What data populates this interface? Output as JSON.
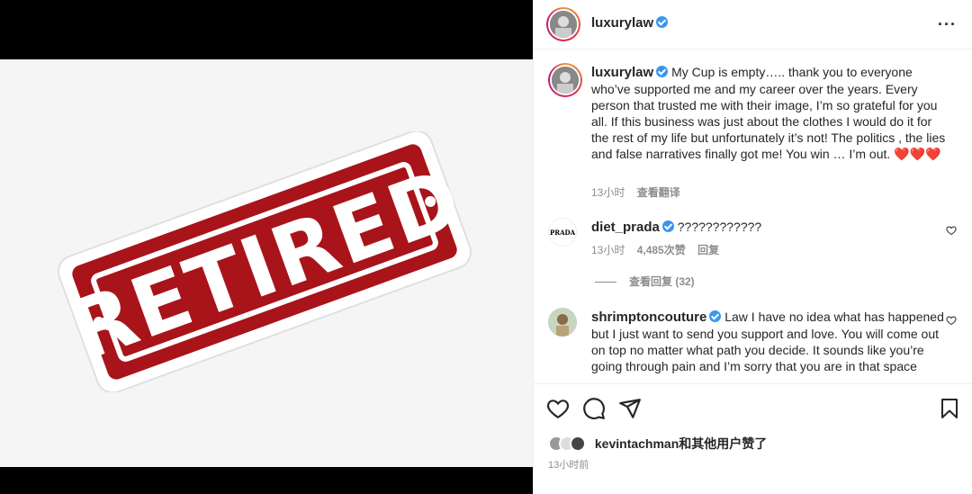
{
  "media": {
    "sticker_text": "RETIRED",
    "colors": {
      "red": "#a8141a",
      "white": "#ffffff"
    }
  },
  "header": {
    "username": "luxurylaw",
    "more_icon": "more-horizontal-icon"
  },
  "caption": {
    "username": "luxurylaw",
    "text": "My Cup is empty….. thank you to everyone who’ve supported me and my career over the years. Every person that trusted me with their image, I’m so grateful for you all. If this business was just about the clothes I would do it for the rest of my life but unfortunately it’s not! The politics , the lies and false narratives finally got me! You win … I’m out. ❤️❤️❤️",
    "time": "13小时",
    "translate": "查看翻译"
  },
  "comments": [
    {
      "username": "diet_prada",
      "avatar_text": "PRADA",
      "text": "????????????",
      "time": "13小时",
      "likes": "4,485次赞",
      "reply": "回复",
      "view_replies": "查看回复 (32)"
    },
    {
      "username": "shrimptoncouture",
      "text": "Law I have no idea what has happened but I just want to send you support and love. You will come out on top no matter what path you decide. It sounds like you’re going through pain and I’m sorry that you are in that space"
    }
  ],
  "actions": {
    "liked_by": "kevintachman和其他用户赞了",
    "time": "13小时前"
  }
}
